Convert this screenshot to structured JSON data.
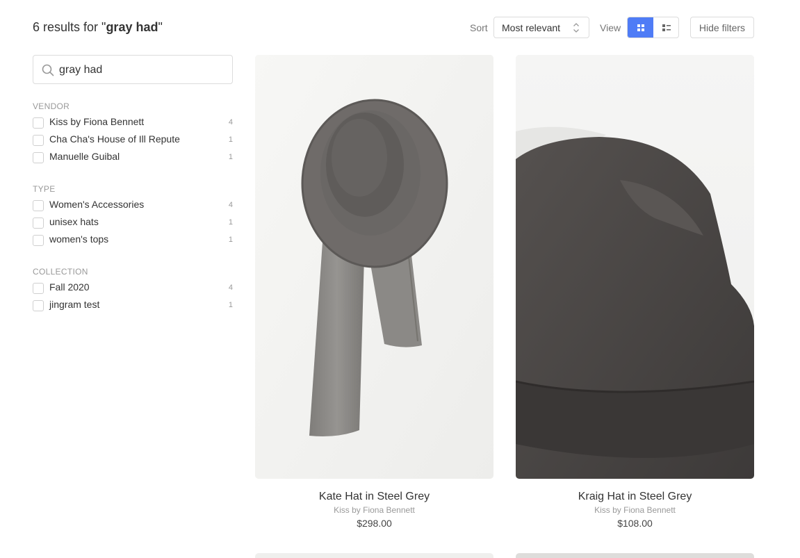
{
  "header": {
    "results_count": "6",
    "results_prefix": " results for \"",
    "query": "gray had",
    "results_suffix": "\"",
    "sort_label": "Sort",
    "sort_value": "Most relevant",
    "view_label": "View",
    "hide_filters": "Hide filters",
    "accent_color": "#4f7cf6"
  },
  "search": {
    "value": "gray had"
  },
  "facets": {
    "vendor": {
      "title": "VENDOR",
      "items": [
        {
          "label": "Kiss by Fiona Bennett",
          "count": "4"
        },
        {
          "label": "Cha Cha's House of Ill Repute",
          "count": "1"
        },
        {
          "label": "Manuelle Guibal",
          "count": "1"
        }
      ]
    },
    "type": {
      "title": "TYPE",
      "items": [
        {
          "label": "Women's Accessories",
          "count": "4"
        },
        {
          "label": "unisex hats",
          "count": "1"
        },
        {
          "label": "women's tops",
          "count": "1"
        }
      ]
    },
    "collection": {
      "title": "COLLECTION",
      "items": [
        {
          "label": "Fall 2020",
          "count": "4"
        },
        {
          "label": "jingram test",
          "count": "1"
        }
      ]
    }
  },
  "products": [
    {
      "title": "Kate Hat in Steel Grey",
      "vendor": "Kiss by Fiona Bennett",
      "price": "$298.00"
    },
    {
      "title": "Kraig Hat in Steel Grey",
      "vendor": "Kiss by Fiona Bennett",
      "price": "$108.00"
    }
  ]
}
